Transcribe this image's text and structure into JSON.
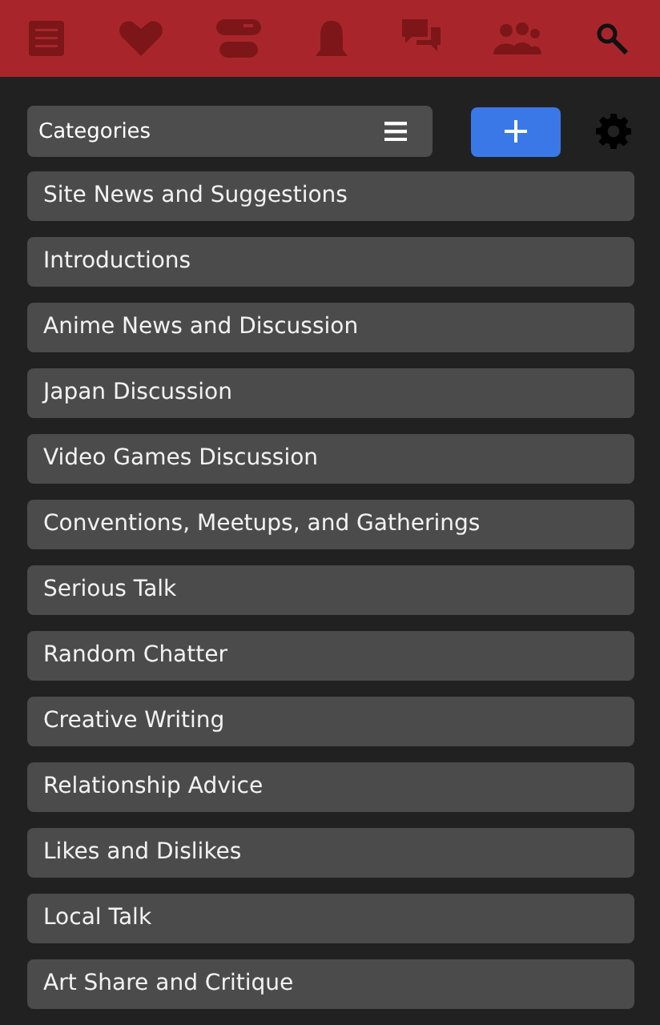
{
  "category_select": {
    "value": "Categories"
  },
  "categories": [
    {
      "label": "Site News and Suggestions"
    },
    {
      "label": "Introductions"
    },
    {
      "label": "Anime News and Discussion"
    },
    {
      "label": "Japan Discussion"
    },
    {
      "label": "Video Games Discussion"
    },
    {
      "label": "Conventions, Meetups, and Gatherings"
    },
    {
      "label": "Serious Talk"
    },
    {
      "label": "Random Chatter"
    },
    {
      "label": "Creative Writing"
    },
    {
      "label": "Relationship Advice"
    },
    {
      "label": "Likes and Dislikes"
    },
    {
      "label": "Local Talk"
    },
    {
      "label": "Art Share and Critique"
    }
  ]
}
